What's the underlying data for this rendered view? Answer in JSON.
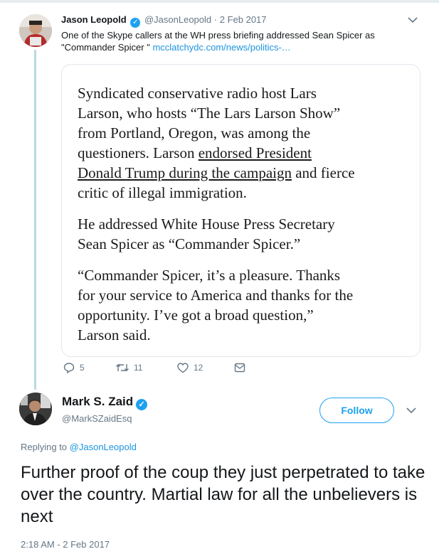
{
  "parent_tweet": {
    "author_name": "Jason Leopold",
    "handle": "@JasonLeopold",
    "separator": "·",
    "date": "2 Feb 2017",
    "text": "One of the Skype callers at the WH press briefing addressed Sean Spicer as \"Commander Spicer \"",
    "link_text": "mcclatchydc.com/news/politics-…",
    "quote": {
      "p1_lines": [
        "Syndicated conservative radio host Lars",
        "Larson, who hosts “The Lars Larson Show”",
        "from Portland, Oregon, was among the",
        "questioners. Larson "
      ],
      "p1_link_a": "endorsed President",
      "p1_link_b": "Donald Trump during the campaign",
      "p1_after_link": " and fierce",
      "p1_last": "critic of illegal immigration.",
      "p2_lines": [
        "He addressed White House Press Secretary",
        "Sean Spicer as “Commander Spicer.”"
      ],
      "p3_lines": [
        "“Commander Spicer, it’s a pleasure. Thanks",
        "for your service to America and thanks for the",
        "opportunity. I’ve got a broad question,”",
        "Larson said."
      ]
    },
    "actions": {
      "replies": "5",
      "retweets": "11",
      "likes": "12"
    }
  },
  "main_tweet": {
    "author_name": "Mark S. Zaid",
    "handle": "@MarkSZaidEsq",
    "follow_label": "Follow",
    "replying_prefix": "Replying to ",
    "replying_to": "@JasonLeopold",
    "text": "Further proof of the coup they just perpetrated to take over the country. Martial law for all the unbelievers is next",
    "timestamp": "2:18 AM - 2 Feb 2017"
  },
  "colors": {
    "accent": "#1da1f2",
    "link": "#1b95e0",
    "muted": "#657786",
    "thread_line": "#b6dbe3"
  }
}
